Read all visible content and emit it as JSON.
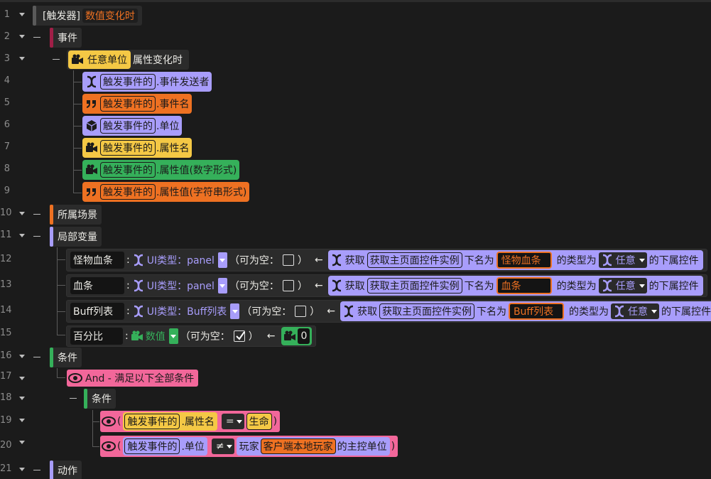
{
  "line_numbers": [
    "1",
    "2",
    "3",
    "4",
    "5",
    "6",
    "7",
    "8",
    "9",
    "10",
    "11",
    "12",
    "13",
    "14",
    "15",
    "16",
    "17",
    "18",
    "19",
    "20",
    "21"
  ],
  "trigger": {
    "prefix": "[触发器]",
    "name": "数值变化时"
  },
  "event_section": "事件",
  "event": {
    "unit": "任意单位",
    "label": "属性变化时"
  },
  "params": [
    {
      "src": "触发事件的",
      "field": ".事件发送者",
      "color": "#a89dfb",
      "icon": "x-variable-icon"
    },
    {
      "src": "触发事件的",
      "field": ".事件名",
      "color": "#ee7122",
      "icon": "quote-icon"
    },
    {
      "src": "触发事件的",
      "field": ".单位",
      "color": "#a89dfb",
      "icon": "cube-icon"
    },
    {
      "src": "触发事件的",
      "field": ".属性名",
      "color": "#f4c845",
      "icon": "camera-icon"
    },
    {
      "src": "触发事件的",
      "field": ".属性值(数字形式)",
      "color": "#35b05a",
      "icon": "camera-icon"
    },
    {
      "src": "触发事件的",
      "field": ".属性值(字符串形式)",
      "color": "#ee7122",
      "icon": "quote-icon"
    }
  ],
  "scene_section": "所属场景",
  "locals_section": "局部变量",
  "locals": [
    {
      "name": "怪物血条",
      "type": "UI类型：panel",
      "nullable": "（可为空：",
      "arrow": "←",
      "get": "获取",
      "func": "获取主页面控件实例",
      "under": "下名为",
      "target": "怪物血条",
      "typeof": "的类型为",
      "any": "任意",
      "tail": "的下属控件"
    },
    {
      "name": "血条",
      "type": "UI类型：panel",
      "nullable": "（可为空：",
      "arrow": "←",
      "get": "获取",
      "func": "获取主页面控件实例",
      "under": "下名为",
      "target": "血条",
      "typeof": "的类型为",
      "any": "任意",
      "tail": "的下属控件"
    },
    {
      "name": "Buff列表",
      "type": "UI类型：Buff列表",
      "nullable": "（可为空：",
      "arrow": "←",
      "get": "获取",
      "func": "获取主页面控件实例",
      "under": "下名为",
      "target": "Buff列表",
      "typeof": "的类型为",
      "any": "任意",
      "tail": "的下属控件"
    }
  ],
  "local4": {
    "name": "百分比",
    "type": "数值",
    "nullable": "（可为空：",
    "arrow": "←",
    "value": "0"
  },
  "paren_close": "）",
  "cond_section": "条件",
  "and_label": "And - 满足以下全部条件",
  "inner_cond": "条件",
  "cond1": {
    "open": "(",
    "src": "触发事件的",
    "field": ".属性名",
    "op": "=",
    "value": "生命",
    "close": ")"
  },
  "cond2": {
    "open": "(",
    "src": "触发事件的",
    "field": ".单位",
    "op": "≠",
    "player": "玩家",
    "client": "客户端本地玩家",
    "tail": "的主控单位",
    "close": ")"
  },
  "action_section": "动作",
  "colors": {
    "event": "#a01f47",
    "scene": "#ee7122",
    "locals": "#a89dfb",
    "conditions": "#35b05a",
    "actions": "#a89dfb",
    "trigger": "#5a5a5a",
    "and": "#f2679a"
  }
}
